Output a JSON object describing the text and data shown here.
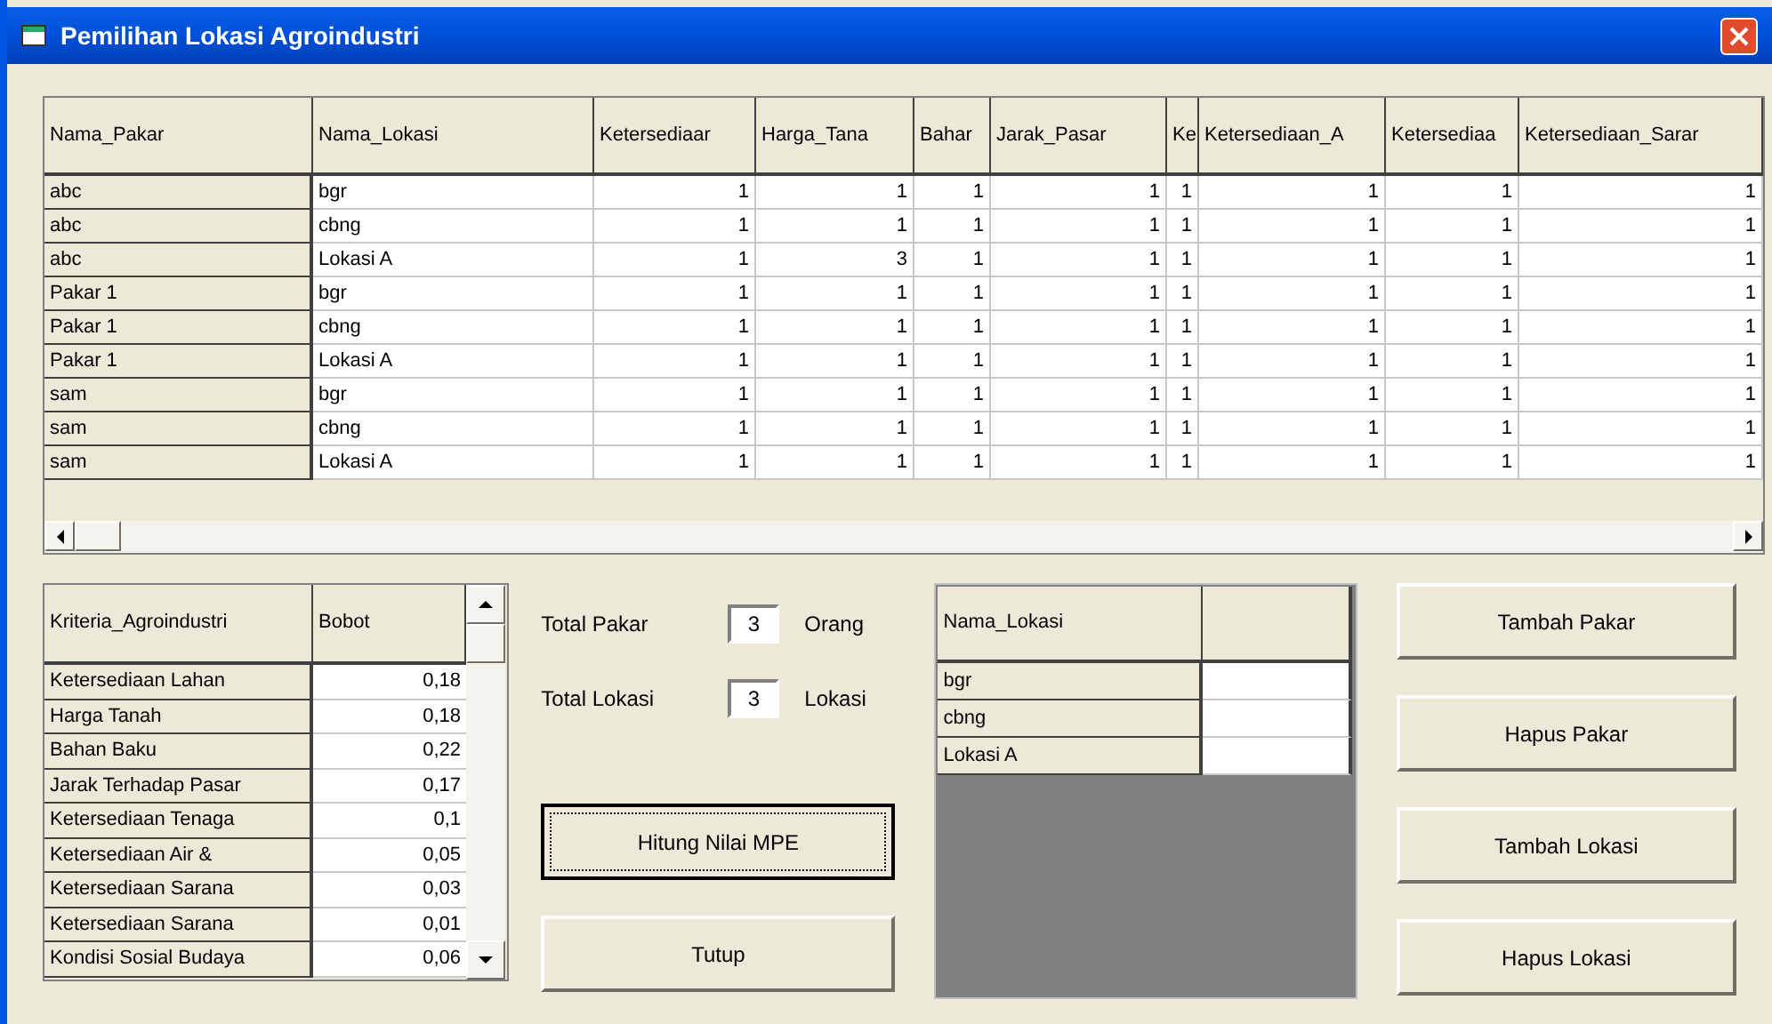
{
  "window": {
    "title": "Pemilihan Lokasi Agroindustri"
  },
  "main_table": {
    "columns": [
      "Nama_Pakar",
      "Nama_Lokasi",
      "Ketersediaar",
      "Harga_Tana",
      "Bahar",
      "Jarak_Pasar",
      "Ke",
      "Ketersediaan_A",
      "Ketersediaa",
      "Ketersediaan_Sarar"
    ],
    "rows": [
      [
        "abc",
        "bgr",
        "1",
        "1",
        "1",
        "1",
        "1",
        "1",
        "1",
        "1"
      ],
      [
        "abc",
        "cbng",
        "1",
        "1",
        "1",
        "1",
        "1",
        "1",
        "1",
        "1"
      ],
      [
        "abc",
        "Lokasi A",
        "1",
        "3",
        "1",
        "1",
        "1",
        "1",
        "1",
        "1"
      ],
      [
        "Pakar 1",
        "bgr",
        "1",
        "1",
        "1",
        "1",
        "1",
        "1",
        "1",
        "1"
      ],
      [
        "Pakar 1",
        "cbng",
        "1",
        "1",
        "1",
        "1",
        "1",
        "1",
        "1",
        "1"
      ],
      [
        "Pakar 1",
        "Lokasi A",
        "1",
        "1",
        "1",
        "1",
        "1",
        "1",
        "1",
        "1"
      ],
      [
        "sam",
        "bgr",
        "1",
        "1",
        "1",
        "1",
        "1",
        "1",
        "1",
        "1"
      ],
      [
        "sam",
        "cbng",
        "1",
        "1",
        "1",
        "1",
        "1",
        "1",
        "1",
        "1"
      ],
      [
        "sam",
        "Lokasi A",
        "1",
        "1",
        "1",
        "1",
        "1",
        "1",
        "1",
        "1"
      ]
    ]
  },
  "criteria_table": {
    "columns": [
      "Kriteria_Agroindustri",
      "Bobot"
    ],
    "rows": [
      [
        "Ketersediaan Lahan",
        "0,18"
      ],
      [
        "Harga Tanah",
        "0,18"
      ],
      [
        "Bahan Baku",
        "0,22"
      ],
      [
        "Jarak Terhadap Pasar",
        "0,17"
      ],
      [
        "Ketersediaan Tenaga",
        "0,1"
      ],
      [
        "Ketersediaan Air &",
        "0,05"
      ],
      [
        "Ketersediaan Sarana",
        "0,03"
      ],
      [
        "Ketersediaan Sarana",
        "0,01"
      ],
      [
        "Kondisi Sosial Budaya",
        "0,06"
      ]
    ]
  },
  "totals": [
    {
      "label": "Total Pakar",
      "value": "3",
      "unit": "Orang"
    },
    {
      "label": "Total Lokasi",
      "value": "3",
      "unit": "Lokasi"
    }
  ],
  "center_buttons": [
    {
      "label": "Hitung Nilai MPE",
      "focused": true
    },
    {
      "label": "Tutup",
      "focused": false
    }
  ],
  "location_table": {
    "columns": [
      "Nama_Lokasi"
    ],
    "rows": [
      "bgr",
      "cbng",
      "Lokasi A"
    ]
  },
  "side_buttons": [
    "Tambah Pakar",
    "Hapus Pakar",
    "Tambah Lokasi",
    "Hapus Lokasi"
  ]
}
